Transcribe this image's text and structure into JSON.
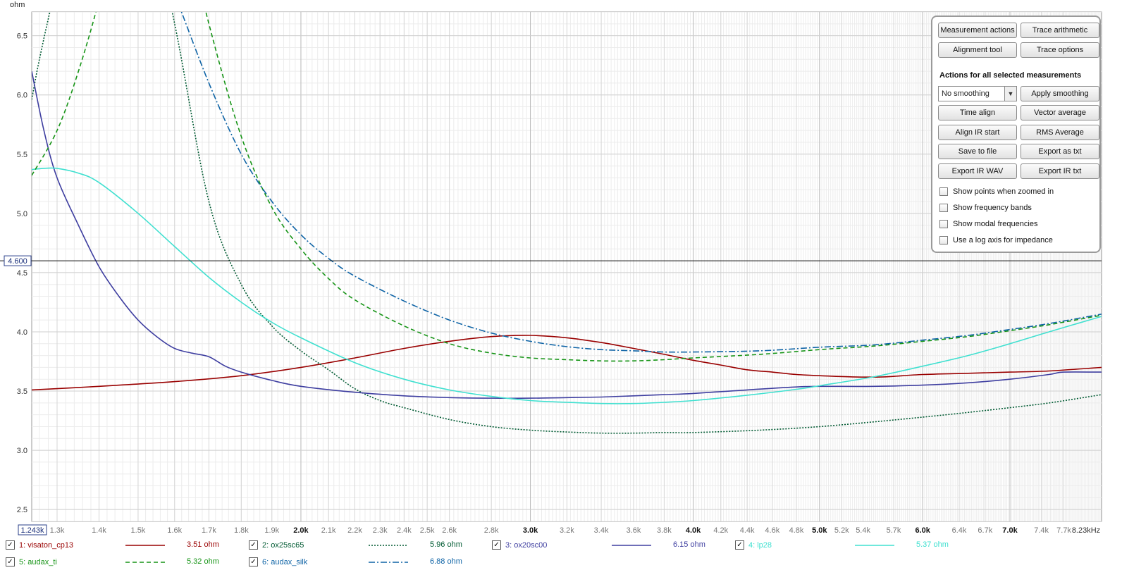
{
  "unit_label": "ohm",
  "cursor_label": "4.600",
  "panel": {
    "buttons": [
      "Measurement actions",
      "Trace arithmetic",
      "Alignment tool",
      "Trace options"
    ],
    "heading": "Actions for all selected measurements",
    "smoothing_select": "No  smoothing",
    "apply_smoothing": "Apply smoothing",
    "action_buttons": [
      "Time align",
      "Vector average",
      "Align IR start",
      "RMS Average",
      "Save to file",
      "Export as txt",
      "Export IR WAV",
      "Export IR txt"
    ],
    "checkboxes": [
      "Show points when zoomed in",
      "Show frequency bands",
      "Show modal frequencies",
      "Use a log axis for impedance"
    ]
  },
  "chart_data": {
    "type": "line",
    "xlim": [
      1243,
      8230
    ],
    "ylim": [
      2.4,
      6.7
    ],
    "x_scale": "log",
    "grid": true,
    "cursor_y": 4.6,
    "y_ticks": [
      2.5,
      3.0,
      3.5,
      4.0,
      4.5,
      5.0,
      5.5,
      6.0,
      6.5
    ],
    "y_tick_labels": [
      "2.5",
      "3.0",
      "3.5",
      "4.0",
      "4.5",
      "5.0",
      "5.5",
      "6.0",
      "6.5"
    ],
    "x_tick_values": [
      1300,
      1400,
      1500,
      1600,
      1700,
      1800,
      1900,
      2000,
      2100,
      2200,
      2300,
      2400,
      2500,
      2600,
      2800,
      3000,
      3200,
      3400,
      3600,
      3800,
      4000,
      4200,
      4400,
      4600,
      4800,
      5000,
      5200,
      5400,
      5700,
      6000,
      6400,
      6700,
      7000,
      7400,
      7700
    ],
    "x_tick_labels": [
      "1.3k",
      "1.4k",
      "1.5k",
      "1.6k",
      "1.7k",
      "1.8k",
      "1.9k",
      "2.0k",
      "2.1k",
      "2.2k",
      "2.3k",
      "2.4k",
      "2.5k",
      "2.6k",
      "2.8k",
      "3.0k",
      "3.2k",
      "3.4k",
      "3.6k",
      "3.8k",
      "4.0k",
      "4.2k",
      "4.4k",
      "4.6k",
      "4.8k",
      "5.0k",
      "5.2k",
      "5.4k",
      "5.7k",
      "6.0k",
      "6.4k",
      "6.7k",
      "7.0k",
      "7.4k",
      "7.7k"
    ],
    "x_bold_ticks": [
      "2.0k",
      "3.0k",
      "4.0k",
      "5.0k",
      "6.0k",
      "7.0k"
    ],
    "x_start_label": "1.243k",
    "x_end_label": "8.23kHz",
    "series": [
      {
        "legend": "1: visaton_cp13",
        "value_label": "3.51 ohm",
        "color": "#990000",
        "dash": "solid",
        "enabled": true,
        "x": [
          1243,
          1400,
          1600,
          1800,
          2000,
          2200,
          2400,
          2600,
          2800,
          3000,
          3200,
          3400,
          3600,
          3800,
          4000,
          4200,
          4400,
          4600,
          4800,
          5000,
          5300,
          5600,
          6000,
          6500,
          7000,
          7500,
          8230
        ],
        "y": [
          3.51,
          3.54,
          3.58,
          3.63,
          3.7,
          3.78,
          3.86,
          3.92,
          3.96,
          3.97,
          3.95,
          3.91,
          3.86,
          3.81,
          3.76,
          3.72,
          3.68,
          3.66,
          3.64,
          3.63,
          3.62,
          3.62,
          3.64,
          3.65,
          3.66,
          3.67,
          3.7
        ]
      },
      {
        "legend": "2: ox25sc65",
        "value_label": "5.96 ohm",
        "color": "#005a32",
        "dash": "dot",
        "enabled": true,
        "x": [
          1243,
          1260,
          1290,
          1340,
          1400,
          1500,
          1600,
          1700,
          1800,
          1900,
          2000,
          2100,
          2200,
          2300,
          2400,
          2600,
          2800,
          3000,
          3200,
          3400,
          3600,
          3800,
          4000,
          4500,
          5000,
          5500,
          6000,
          6500,
          7000,
          7500,
          8230
        ],
        "y": [
          5.96,
          6.3,
          6.8,
          7.5,
          8.0,
          8.0,
          6.6,
          5.1,
          4.4,
          4.05,
          3.84,
          3.68,
          3.52,
          3.42,
          3.36,
          3.26,
          3.2,
          3.17,
          3.155,
          3.145,
          3.145,
          3.15,
          3.15,
          3.17,
          3.2,
          3.24,
          3.28,
          3.32,
          3.36,
          3.4,
          3.47
        ]
      },
      {
        "legend": "3: ox20sc00",
        "value_label": "6.15 ohm",
        "color": "#3e3ea0",
        "dash": "solid",
        "enabled": true,
        "x": [
          1243,
          1270,
          1300,
          1350,
          1400,
          1450,
          1500,
          1550,
          1600,
          1650,
          1700,
          1750,
          1800,
          1900,
          2000,
          2200,
          2400,
          2600,
          2800,
          3000,
          3200,
          3400,
          3600,
          3800,
          4000,
          4400,
          4800,
          5000,
          5500,
          6000,
          6500,
          7000,
          7500,
          7700,
          8230
        ],
        "y": [
          6.2,
          5.7,
          5.3,
          4.9,
          4.55,
          4.3,
          4.1,
          3.96,
          3.86,
          3.82,
          3.79,
          3.71,
          3.66,
          3.59,
          3.54,
          3.49,
          3.46,
          3.445,
          3.44,
          3.44,
          3.445,
          3.45,
          3.46,
          3.47,
          3.48,
          3.51,
          3.535,
          3.54,
          3.54,
          3.55,
          3.57,
          3.6,
          3.64,
          3.66,
          3.66
        ]
      },
      {
        "legend": "4: lp28",
        "value_label": "5.37 ohm",
        "color": "#40e0d0",
        "dash": "solid",
        "enabled": true,
        "x": [
          1243,
          1270,
          1300,
          1350,
          1400,
          1500,
          1600,
          1700,
          1800,
          1900,
          2000,
          2200,
          2400,
          2600,
          2800,
          3000,
          3200,
          3400,
          3600,
          3800,
          4000,
          4400,
          4800,
          5000,
          5500,
          6000,
          6500,
          7000,
          7500,
          8230
        ],
        "y": [
          5.37,
          5.38,
          5.38,
          5.34,
          5.26,
          5.0,
          4.72,
          4.46,
          4.25,
          4.08,
          3.95,
          3.74,
          3.6,
          3.51,
          3.455,
          3.42,
          3.405,
          3.395,
          3.395,
          3.405,
          3.42,
          3.465,
          3.515,
          3.545,
          3.62,
          3.71,
          3.8,
          3.9,
          4.0,
          4.13
        ]
      },
      {
        "legend": "5: audax_ti",
        "value_label": "5.32 ohm",
        "color": "#169416",
        "dash": "dash",
        "enabled": true,
        "x": [
          1243,
          1300,
          1350,
          1400,
          1450,
          1500,
          1550,
          1600,
          1700,
          1800,
          1900,
          2000,
          2100,
          2200,
          2400,
          2600,
          2800,
          3000,
          3200,
          3400,
          3600,
          3800,
          4000,
          4500,
          5000,
          5500,
          6000,
          6500,
          7000,
          7500,
          8230
        ],
        "y": [
          5.32,
          5.7,
          6.2,
          6.8,
          7.5,
          8.2,
          8.2,
          7.8,
          6.6,
          5.65,
          5.05,
          4.7,
          4.45,
          4.27,
          4.05,
          3.9,
          3.82,
          3.78,
          3.765,
          3.755,
          3.755,
          3.765,
          3.78,
          3.81,
          3.85,
          3.88,
          3.92,
          3.96,
          4.01,
          4.06,
          4.14
        ]
      },
      {
        "legend": "6: audax_silk",
        "value_label": "6.88 ohm",
        "color": "#0f64a6",
        "dash": "dashdot",
        "enabled": true,
        "x": [
          1500,
          1550,
          1600,
          1700,
          1800,
          1900,
          2000,
          2100,
          2200,
          2400,
          2600,
          2800,
          3000,
          3200,
          3400,
          3600,
          3800,
          4000,
          4500,
          5000,
          5500,
          6000,
          6500,
          7000,
          7500,
          8230
        ],
        "y": [
          7.5,
          7.2,
          6.85,
          6.1,
          5.5,
          5.1,
          4.82,
          4.62,
          4.47,
          4.26,
          4.1,
          3.99,
          3.92,
          3.875,
          3.85,
          3.84,
          3.83,
          3.83,
          3.84,
          3.87,
          3.89,
          3.93,
          3.97,
          4.02,
          4.07,
          4.15
        ]
      }
    ]
  }
}
